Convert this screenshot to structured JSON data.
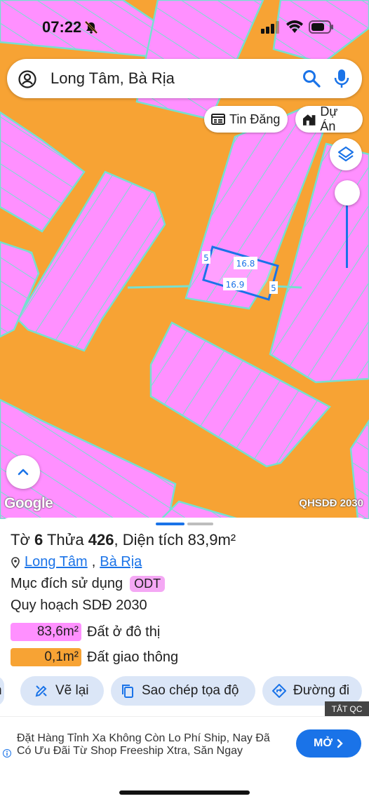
{
  "status_bar": {
    "time": "07:22"
  },
  "search": {
    "text": "Long Tâm, Bà Rịa"
  },
  "chips": [
    {
      "label": "Tin Đăng",
      "icon": "listing-icon"
    },
    {
      "label": "Dự Án",
      "icon": "building-icon"
    }
  ],
  "map": {
    "dimension_labels": [
      "16.8",
      "16.9",
      "5",
      "5"
    ],
    "google_logo": "Google",
    "layer_label": "QHSDĐ 2030",
    "colors": {
      "road": "#f7a334",
      "land": "#ff90ff",
      "outline": "#76e0d0",
      "selection": "#1a73e8"
    }
  },
  "parcel": {
    "title_prefix": "Tờ",
    "sheet_no": "6",
    "plot_word": "Thửa",
    "plot_no": "426",
    "area_label": "Diện tích",
    "area_value": "83,9m²",
    "ward": "Long Tâm",
    "city": "Bà Rịa",
    "purpose_label": "Mục đích sử dụng",
    "purpose_code": "ODT",
    "plan_label": "Quy hoạch SDĐ 2030",
    "land_uses": [
      {
        "area": "83,6m²",
        "label": "Đất ở đô thị",
        "color": "#ff90ff"
      },
      {
        "area": "0,1m²",
        "label": "Đất giao thông",
        "color": "#f7a334"
      }
    ]
  },
  "actions": [
    {
      "label": "n",
      "icon": "partial-icon"
    },
    {
      "label": "Vẽ lại",
      "icon": "redraw-icon"
    },
    {
      "label": "Sao chép tọa độ",
      "icon": "copy-icon"
    },
    {
      "label": "Đường đi",
      "icon": "directions-icon"
    }
  ],
  "ad": {
    "tag": "TẮT QC",
    "text": "Đặt Hàng Tỉnh Xa Không Còn Lo Phí Ship, Nay Đã Có Ưu Đãi Từ Shop Freeship Xtra, Săn Ngay",
    "button": "MỞ"
  }
}
